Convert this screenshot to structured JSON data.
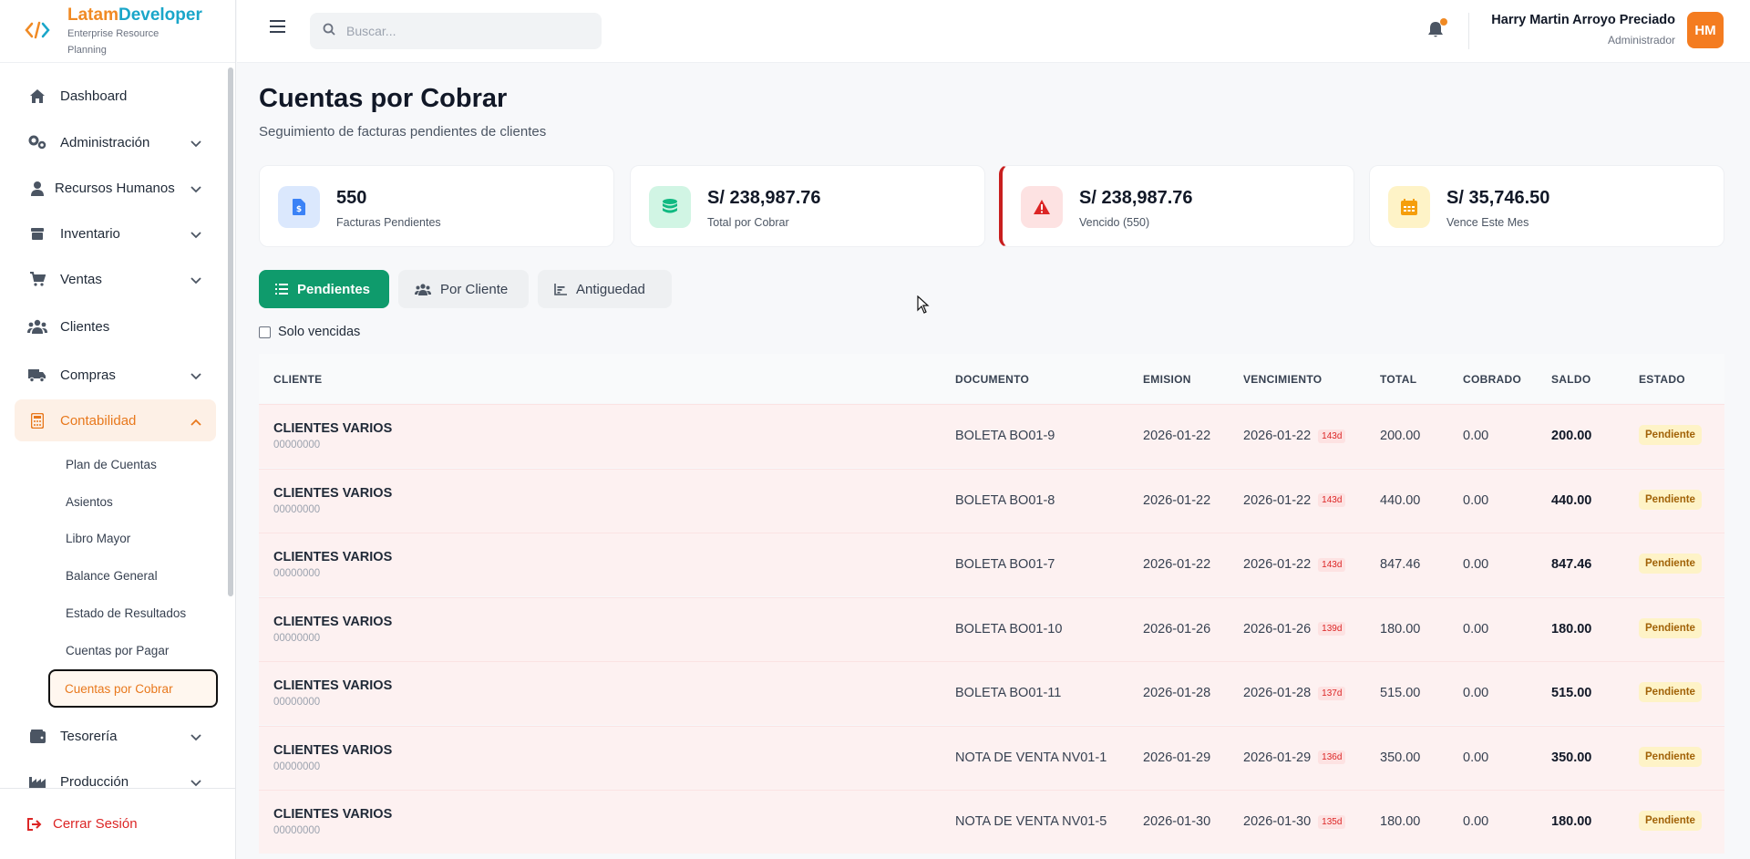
{
  "brand": {
    "name_a": "Latam",
    "name_b": "Developer",
    "subtitle": "Enterprise Resource Planning"
  },
  "sidebar": {
    "items": [
      {
        "label": "Dashboard",
        "icon": "home-icon"
      },
      {
        "label": "Administración",
        "icon": "gears-icon"
      },
      {
        "label": "Recursos Humanos",
        "icon": "user-icon"
      },
      {
        "label": "Inventario",
        "icon": "box-icon"
      },
      {
        "label": "Ventas",
        "icon": "cart-icon"
      },
      {
        "label": "Clientes",
        "icon": "users-icon"
      },
      {
        "label": "Compras",
        "icon": "truck-icon"
      },
      {
        "label": "Contabilidad",
        "icon": "calculator-icon"
      },
      {
        "label": "Tesorería",
        "icon": "wallet-icon"
      },
      {
        "label": "Producción",
        "icon": "factory-icon"
      }
    ],
    "sub_items": [
      "Plan de Cuentas",
      "Asientos",
      "Libro Mayor",
      "Balance General",
      "Estado de Resultados",
      "Cuentas por Pagar",
      "Cuentas por Cobrar"
    ],
    "logout": "Cerrar Sesión"
  },
  "topbar": {
    "search_placeholder": "Buscar...",
    "user_name": "Harry Martin Arroyo Preciado",
    "user_role": "Administrador",
    "avatar_initials": "HM"
  },
  "page": {
    "title": "Cuentas por Cobrar",
    "subtitle": "Seguimiento de facturas pendientes de clientes"
  },
  "stats": [
    {
      "value": "550",
      "label": "Facturas Pendientes",
      "color": "#3b82f6"
    },
    {
      "value": "S/ 238,987.76",
      "label": "Total por Cobrar",
      "color": "#10b981"
    },
    {
      "value": "S/ 238,987.76",
      "label": "Vencido (550)",
      "color": "#dc2626"
    },
    {
      "value": "S/ 35,746.50",
      "label": "Vence Este Mes",
      "color": "#f59e0b"
    }
  ],
  "tabs": [
    "Pendientes",
    "Por Cliente",
    "Antiguedad"
  ],
  "filter": {
    "solo_vencidas": "Solo vencidas"
  },
  "table": {
    "headers": [
      "CLIENTE",
      "DOCUMENTO",
      "EMISION",
      "VENCIMIENTO",
      "TOTAL",
      "COBRADO",
      "SALDO",
      "ESTADO"
    ],
    "rows": [
      {
        "cliente": "CLIENTES VARIOS",
        "doc_num": "00000000",
        "documento": "BOLETA BO01-9",
        "emision": "2026-01-22",
        "vencimiento": "2026-01-22",
        "dias": "143d",
        "total": "200.00",
        "cobrado": "0.00",
        "saldo": "200.00",
        "estado": "Pendiente"
      },
      {
        "cliente": "CLIENTES VARIOS",
        "doc_num": "00000000",
        "documento": "BOLETA BO01-8",
        "emision": "2026-01-22",
        "vencimiento": "2026-01-22",
        "dias": "143d",
        "total": "440.00",
        "cobrado": "0.00",
        "saldo": "440.00",
        "estado": "Pendiente"
      },
      {
        "cliente": "CLIENTES VARIOS",
        "doc_num": "00000000",
        "documento": "BOLETA BO01-7",
        "emision": "2026-01-22",
        "vencimiento": "2026-01-22",
        "dias": "143d",
        "total": "847.46",
        "cobrado": "0.00",
        "saldo": "847.46",
        "estado": "Pendiente"
      },
      {
        "cliente": "CLIENTES VARIOS",
        "doc_num": "00000000",
        "documento": "BOLETA BO01-10",
        "emision": "2026-01-26",
        "vencimiento": "2026-01-26",
        "dias": "139d",
        "total": "180.00",
        "cobrado": "0.00",
        "saldo": "180.00",
        "estado": "Pendiente"
      },
      {
        "cliente": "CLIENTES VARIOS",
        "doc_num": "00000000",
        "documento": "BOLETA BO01-11",
        "emision": "2026-01-28",
        "vencimiento": "2026-01-28",
        "dias": "137d",
        "total": "515.00",
        "cobrado": "0.00",
        "saldo": "515.00",
        "estado": "Pendiente"
      },
      {
        "cliente": "CLIENTES VARIOS",
        "doc_num": "00000000",
        "documento": "NOTA DE VENTA NV01-1",
        "emision": "2026-01-29",
        "vencimiento": "2026-01-29",
        "dias": "136d",
        "total": "350.00",
        "cobrado": "0.00",
        "saldo": "350.00",
        "estado": "Pendiente"
      },
      {
        "cliente": "CLIENTES VARIOS",
        "doc_num": "00000000",
        "documento": "NOTA DE VENTA NV01-5",
        "emision": "2026-01-30",
        "vencimiento": "2026-01-30",
        "dias": "135d",
        "total": "180.00",
        "cobrado": "0.00",
        "saldo": "180.00",
        "estado": "Pendiente"
      }
    ]
  }
}
